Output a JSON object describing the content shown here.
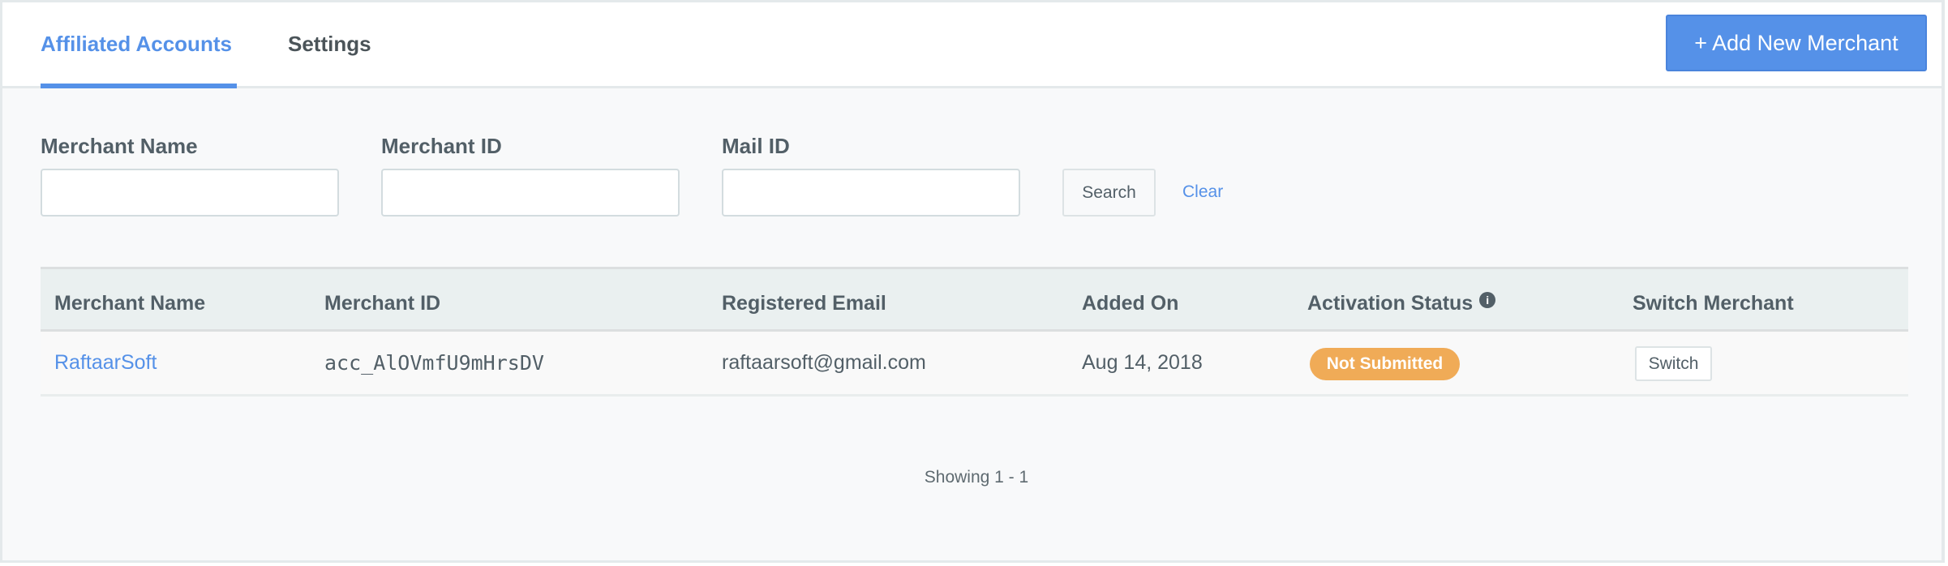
{
  "tabs": [
    {
      "label": "Affiliated Accounts",
      "active": true
    },
    {
      "label": "Settings",
      "active": false
    }
  ],
  "add_button": "+ Add New Merchant",
  "filters": {
    "merchant_name": {
      "label": "Merchant Name",
      "value": ""
    },
    "merchant_id": {
      "label": "Merchant ID",
      "value": ""
    },
    "mail_id": {
      "label": "Mail ID",
      "value": ""
    },
    "search_label": "Search",
    "clear_label": "Clear"
  },
  "table": {
    "columns": [
      "Merchant Name",
      "Merchant ID",
      "Registered Email",
      "Added On",
      "Activation Status",
      "Switch Merchant"
    ],
    "rows": [
      {
        "name": "RaftaarSoft",
        "id": "acc_AlOVmfU9mHrsDV",
        "email": "raftaarsoft@gmail.com",
        "added_on": "Aug 14, 2018",
        "status": "Not Submitted",
        "action": "Switch"
      }
    ]
  },
  "pagination": "Showing 1 - 1",
  "colors": {
    "accent": "#5591e8",
    "status_not_submitted": "#f0ab57"
  },
  "icons": {
    "info": "info-circle-icon"
  }
}
